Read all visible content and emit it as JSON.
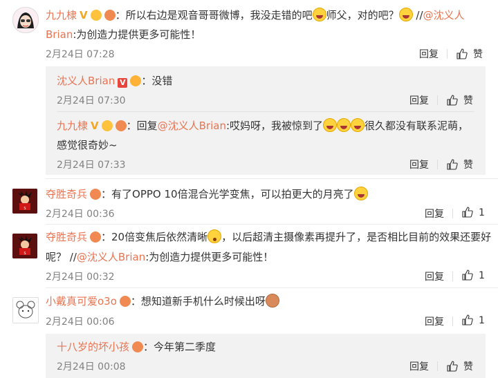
{
  "comments": [
    {
      "user": "九九棣",
      "text1_pre": "：所以右边是观音哥哥微博，我没走错的吧",
      "text1_mid": "师父，对的吧？",
      "text1_post": " //",
      "mention": "@沈义人",
      "line2_mention": "Brian",
      "line2_text": ":为创造力提供更多可能性！",
      "time": "2月24日 07:28",
      "reply_label": "回复",
      "like_label": "赞"
    },
    {
      "user": "沈义人Brian",
      "text": "：没错",
      "time": "2月24日 07:30",
      "reply_label": "回复",
      "like_label": "赞"
    },
    {
      "user": "九九棣",
      "text_pre": "：回复",
      "mention": "@沈义人Brian",
      "text_post": ":哎妈呀，我被惊到了",
      "text_post2": "很久都没有联系泥萌，",
      "line2": "感觉很奇妙~",
      "time": "2月24日 07:33",
      "reply_label": "回复",
      "like_label": "赞"
    },
    {
      "user": "夺胜奇兵",
      "text": "：有了OPPO 10倍混合光学变焦，可以拍更大的月亮了",
      "time": "2月24日 00:36",
      "reply_label": "回复",
      "like_count": "1"
    },
    {
      "user": "夺胜奇兵",
      "text_pre": "：20倍变焦后依然清晰",
      "text_post": "，以后超清主摄像素再提升了，是否相比目前的效果还要好",
      "line2_pre": "呢？ //",
      "mention": "@沈义人Brian",
      "line2_post": ":为创造力提供更多可能性！",
      "time": "2月24日 00:32",
      "reply_label": "回复",
      "like_count": "1"
    },
    {
      "user": "小戴真可爱o3o",
      "text": "：想知道新手机什么时候出呀",
      "time": "2月24日 00:06",
      "reply_label": "回复",
      "like_count": "1"
    },
    {
      "user": "十八岁的坏小孩",
      "text": "：今年第二季度",
      "time": "2月24日 00:08",
      "reply_label": "回复",
      "like_label": "赞"
    }
  ],
  "colors": {
    "username": "#eb7350",
    "meta": "#808080",
    "reply_bg": "#f2f2f2"
  }
}
